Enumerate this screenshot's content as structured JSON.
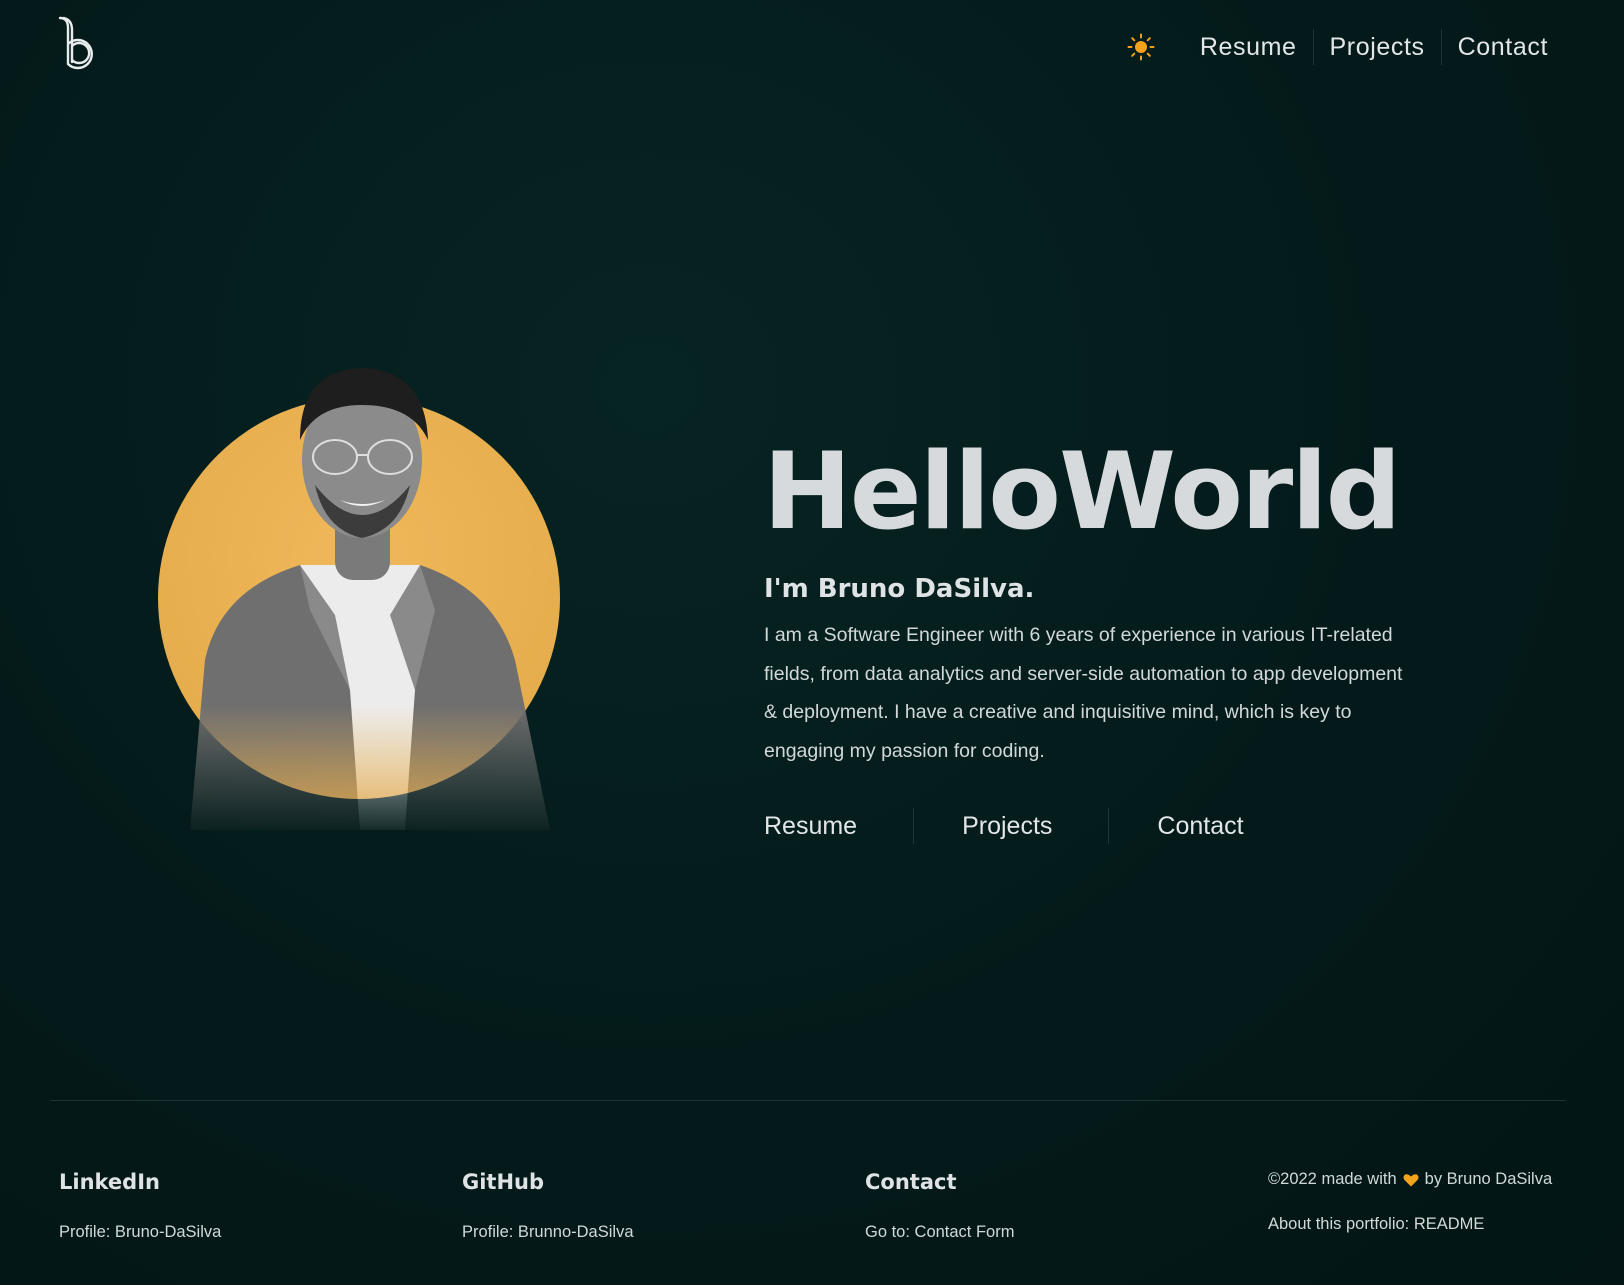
{
  "header": {
    "logo_icon": "b-monogram-logo",
    "theme_icon": "sun-icon",
    "accent": "#f2a21b",
    "nav": [
      {
        "label": "Resume"
      },
      {
        "label": "Projects"
      },
      {
        "label": "Contact"
      }
    ]
  },
  "hero": {
    "headline": "HelloWorld",
    "intro": "I'm Bruno DaSilva.",
    "bio": "I am a Software Engineer with 6 years of experience in various IT-related fields, from data analytics and server-side automation to app development & deployment. I have a creative and inquisitive mind, which is key to engaging my passion for coding.",
    "links": [
      {
        "label": "Resume"
      },
      {
        "label": "Projects"
      },
      {
        "label": "Contact"
      }
    ],
    "avatar_bg": "#e8b04f"
  },
  "footer": {
    "columns": [
      {
        "title": "LinkedIn",
        "link": "Profile: Bruno-DaSilva"
      },
      {
        "title": "GitHub",
        "link": "Profile: Brunno-DaSilva"
      },
      {
        "title": "Contact",
        "link": "Go to: Contact Form"
      }
    ],
    "copyright_prefix": "©2022 made with",
    "copyright_suffix": "by Bruno DaSilva",
    "heart_icon": "heart-icon",
    "readme": "About this portfolio: README"
  }
}
